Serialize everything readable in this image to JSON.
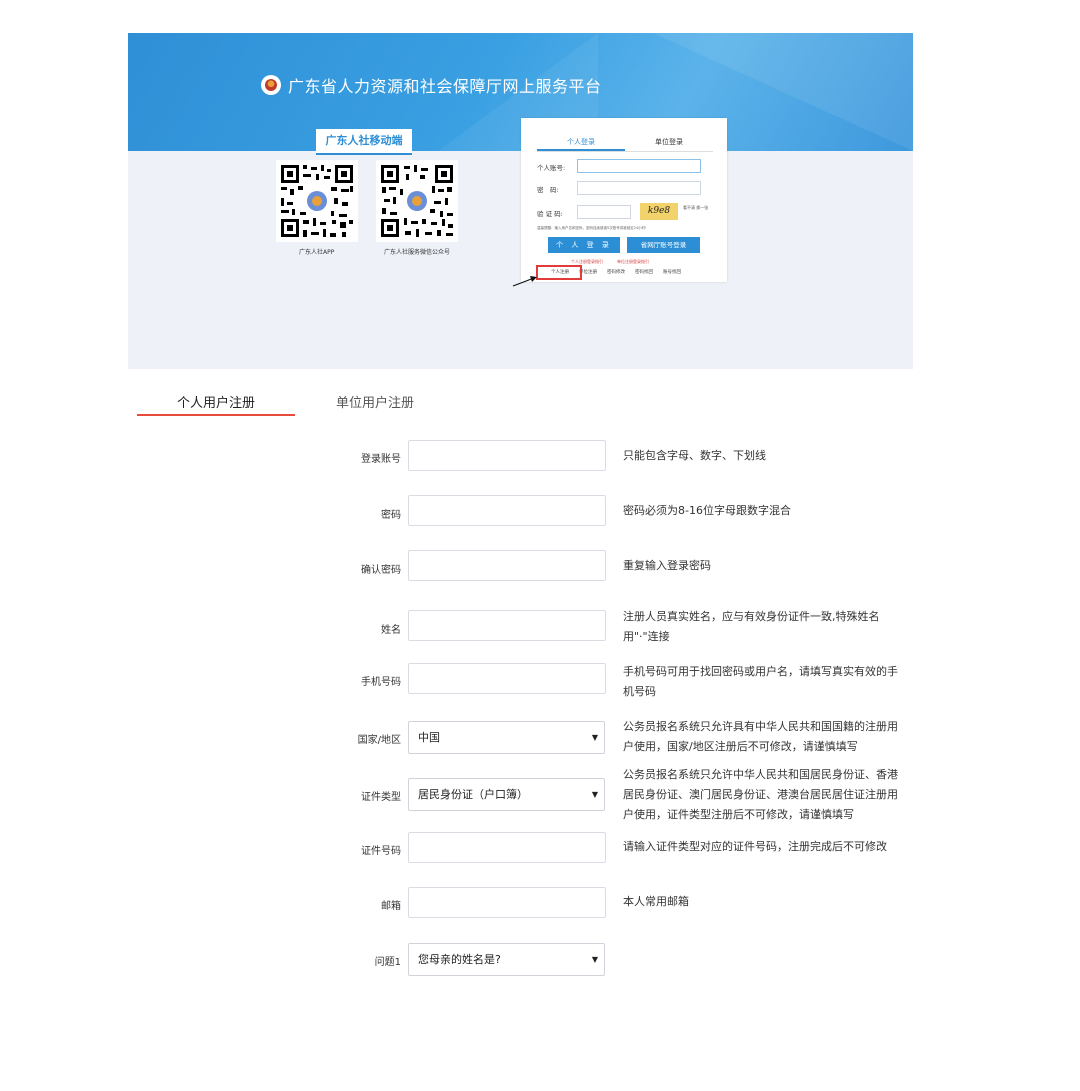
{
  "banner": {
    "site_title": "广东省人力资源和社会保障厅网上服务平台",
    "mobile_tab": "广东人社移动端",
    "qr_app_caption": "广东人社APP",
    "qr_wechat_caption": "广东人社服务微信公众号"
  },
  "login_box": {
    "tab_personal": "个人登录",
    "tab_unit": "单位登录",
    "account_label": "个人账号:",
    "password_label": "密　码:",
    "captcha_label": "验 证 码:",
    "captcha_text": "k9e8",
    "captcha_refresh": "看不清 换一张",
    "hint": "温馨提醒：输入用户名和密码，密码连续错误5次账号将被锁定24小时!",
    "login_button": "个 人 登 录",
    "portal_login_button": "省网厅账号登录",
    "guide_personal": "个人注册登录指引",
    "guide_unit": "单位注册登录指引",
    "links": [
      "个人注册",
      "单位注册",
      "密码修改",
      "密码找回",
      "账号找回"
    ]
  },
  "tabs": {
    "personal": "个人用户注册",
    "unit": "单位用户注册"
  },
  "form": {
    "fields": [
      {
        "label": "登录账号",
        "hint": "只能包含字母、数字、下划线"
      },
      {
        "label": "密码",
        "hint": "密码必须为8-16位字母跟数字混合"
      },
      {
        "label": "确认密码",
        "hint": "重复输入登录密码"
      },
      {
        "label": "姓名",
        "hint": "注册人员真实姓名，应与有效身份证件一致,特殊姓名用\"·\"连接"
      },
      {
        "label": "手机号码",
        "hint": "手机号码可用于找回密码或用户名，请填写真实有效的手机号码"
      },
      {
        "label": "国家/地区",
        "value": "中国",
        "hint": "公务员报名系统只允许具有中华人民共和国国籍的注册用户使用，国家/地区注册后不可修改，请谨慎填写"
      },
      {
        "label": "证件类型",
        "value": "居民身份证（户口簿）",
        "hint": "公务员报名系统只允许中华人民共和国居民身份证、香港居民身份证、澳门居民身份证、港澳台居民居住证注册用户使用，证件类型注册后不可修改，请谨慎填写"
      },
      {
        "label": "证件号码",
        "hint": "请输入证件类型对应的证件号码，注册完成后不可修改"
      },
      {
        "label": "邮箱",
        "hint": "本人常用邮箱"
      },
      {
        "label": "问题1",
        "value": "您母亲的姓名是?"
      }
    ]
  }
}
